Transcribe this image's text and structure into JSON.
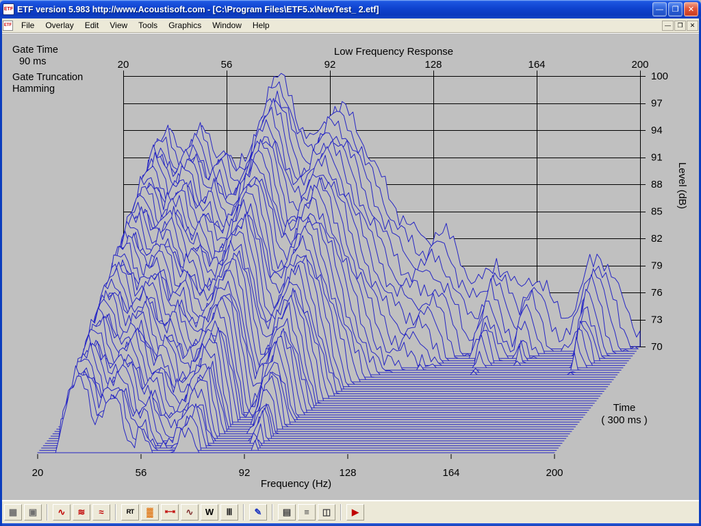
{
  "window": {
    "title": "ETF version 5.983 http://www.Acoustisoft.com - [C:\\Program Files\\ETF5.x\\NewTest_ 2.etf]",
    "icon_text": "ETF",
    "controls": [
      {
        "name": "minimize-button",
        "glyph": "—"
      },
      {
        "name": "restore-button",
        "glyph": "❐"
      },
      {
        "name": "close-button",
        "glyph": "✕",
        "kind": "close"
      }
    ]
  },
  "menu": {
    "items": [
      "File",
      "Overlay",
      "Edit",
      "View",
      "Tools",
      "Graphics",
      "Window",
      "Help"
    ]
  },
  "panel": {
    "gate_time_label": "Gate Time",
    "gate_time_value": "90 ms",
    "gate_truncation_label": "Gate Truncation",
    "gate_truncation_value": "Hamming"
  },
  "chart_data": {
    "type": "waterfall",
    "title": "Low Frequency Response",
    "xlabel": "Frequency (Hz)",
    "ylabel": "Level (dB)",
    "time_label_line1": "Time",
    "time_label_line2": "( 300 ms )",
    "freq_ticks": [
      20,
      56,
      92,
      128,
      164,
      200
    ],
    "level_ticks": [
      100,
      97,
      94,
      91,
      88,
      85,
      82,
      79,
      76,
      73,
      70
    ],
    "xlim": [
      20,
      200
    ],
    "ylim": [
      70,
      100
    ],
    "time_span_ms": 300,
    "num_traces": 46,
    "trace_color": "#2424c4",
    "grid_color": "#000000",
    "background": "#c0c0c0",
    "base_response": {
      "freq_hz": [
        20,
        24,
        28,
        32,
        36,
        40,
        44,
        48,
        52,
        56,
        60,
        64,
        68,
        72,
        75,
        78,
        82,
        86,
        90,
        94,
        98,
        102,
        106,
        110,
        114,
        118,
        122,
        126,
        130,
        134,
        138,
        142,
        146,
        150,
        154,
        158,
        162,
        166,
        170,
        174,
        178,
        182,
        186,
        190,
        194,
        198,
        200
      ],
      "level_db": [
        71,
        80,
        89,
        93,
        94,
        91,
        93,
        94.5,
        90.5,
        92.5,
        89.5,
        91,
        95,
        99,
        100,
        98.5,
        94,
        92.5,
        95,
        96.5,
        96,
        94,
        91,
        88.5,
        86,
        84,
        82.5,
        82,
        82.8,
        82,
        79.5,
        77,
        77.5,
        79.5,
        78,
        76,
        78,
        77,
        74.5,
        73.5,
        74.5,
        79,
        80.5,
        78,
        75,
        72.5,
        71.5
      ]
    },
    "decay_db_per_trace": {
      "freq_hz": [
        20,
        28,
        36,
        44,
        52,
        60,
        68,
        75,
        82,
        88,
        95,
        102,
        110,
        118,
        126,
        134,
        142,
        150,
        158,
        162,
        170,
        178,
        184,
        192,
        200
      ],
      "rate": [
        0.42,
        0.34,
        0.36,
        0.4,
        0.43,
        0.46,
        0.55,
        0.62,
        0.85,
        0.68,
        0.6,
        0.85,
        1.1,
        1.3,
        1.15,
        1.4,
        1.8,
        0.8,
        1.6,
        0.95,
        1.9,
        2.0,
        0.75,
        1.8,
        2.1
      ]
    }
  },
  "toolbar": {
    "groups": [
      [
        {
          "name": "spl-meter-button",
          "glyph": "▦",
          "color": "#707070"
        },
        {
          "name": "dual-view-button",
          "glyph": "▣",
          "color": "#707070"
        }
      ],
      [
        {
          "name": "impulse-response-button",
          "glyph": "∿",
          "color": "#c00000"
        },
        {
          "name": "waterfall-button",
          "glyph": "≋",
          "color": "#c00000"
        },
        {
          "name": "frequency-response-button",
          "glyph": "≈",
          "color": "#c00000"
        }
      ],
      [
        {
          "name": "rt60-button",
          "glyph": "RT",
          "color": "#000000",
          "small": true
        },
        {
          "name": "spectrogram-button",
          "glyph": "▓",
          "color": "#e07818"
        },
        {
          "name": "time-gating-button",
          "glyph": "⇤⇥",
          "color": "#c00000",
          "small": true
        },
        {
          "name": "step-response-button",
          "glyph": "∿",
          "color": "#803030"
        },
        {
          "name": "window-function-button",
          "glyph": "W",
          "color": "#000000"
        },
        {
          "name": "comb-filter-button",
          "glyph": "Ⅲ",
          "color": "#202020"
        }
      ],
      [
        {
          "name": "tools-button",
          "glyph": "✎",
          "color": "#2038c0"
        }
      ],
      [
        {
          "name": "print-button",
          "glyph": "▤",
          "color": "#404040"
        },
        {
          "name": "report-button",
          "glyph": "≡",
          "color": "#404040"
        },
        {
          "name": "overlay-chart-button",
          "glyph": "◫",
          "color": "#404040"
        }
      ],
      [
        {
          "name": "run-measurement-button",
          "glyph": "▶",
          "color": "#c00000"
        }
      ]
    ]
  }
}
